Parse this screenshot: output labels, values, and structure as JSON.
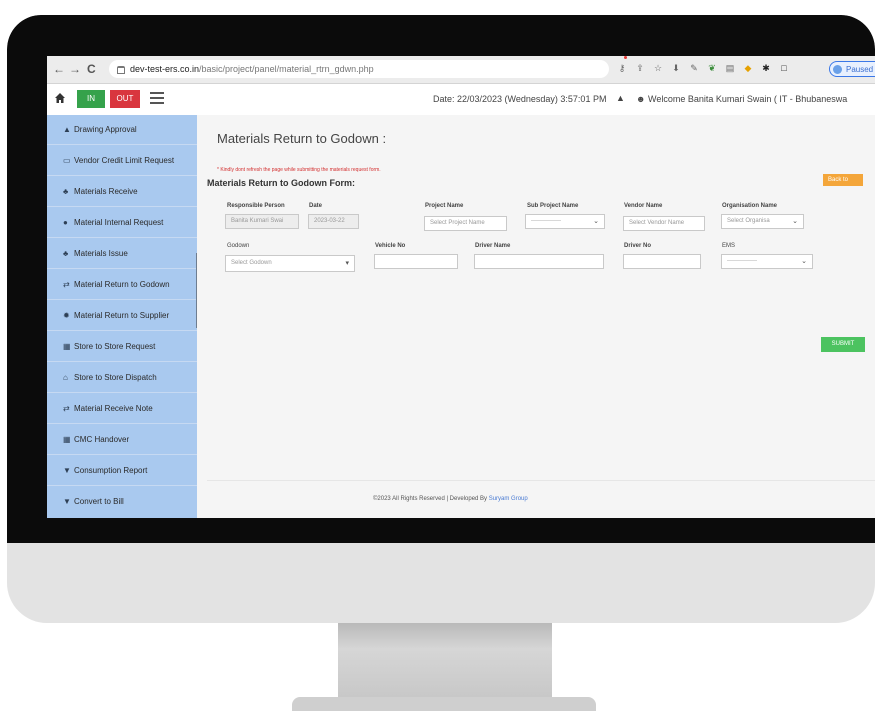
{
  "browser": {
    "back_glyph": "←",
    "forward_glyph": "→",
    "reload_glyph": "C",
    "url_host": "dev-test-ers.co.in",
    "url_path": "/basic/project/panel/material_rtrn_gdwn.php",
    "profile_status": "Paused"
  },
  "header": {
    "in_label": "IN",
    "out_label": "OUT",
    "date_text": "Date: 22/03/2023 (Wednesday) 3:57:01 PM",
    "welcome_text": "Welcome Banita Kumari Swain ( IT - Bhubaneswa"
  },
  "sidebar": {
    "items": [
      {
        "label": "Drawing Approval",
        "icon": "drawing-icon"
      },
      {
        "label": "Vendor Credit Limit Request",
        "icon": "credit-card-icon"
      },
      {
        "label": "Materials Receive",
        "icon": "handshake-icon"
      },
      {
        "label": "Material Internal Request",
        "icon": "globe-icon"
      },
      {
        "label": "Materials Issue",
        "icon": "handshake-icon"
      },
      {
        "label": "Material Return to Godown",
        "icon": "exchange-icon"
      },
      {
        "label": "Material Return to Supplier",
        "icon": "gear-icon"
      },
      {
        "label": "Store to Store Request",
        "icon": "table-icon"
      },
      {
        "label": "Store to Store Dispatch",
        "icon": "bank-icon"
      },
      {
        "label": "Material Receive Note",
        "icon": "exchange-icon"
      },
      {
        "label": "CMC Handover",
        "icon": "grid-icon"
      },
      {
        "label": "Consumption Report",
        "icon": "cart-icon"
      },
      {
        "label": "Convert to Bill",
        "icon": "cart-icon"
      }
    ]
  },
  "main": {
    "page_title": "Materials Return to Godown :",
    "warning": "* Kindly dont refresh the page while submitting the materials request form.",
    "form_title": "Materials Return to Godown Form:",
    "back_label": "Back to",
    "submit_label": "SUBMIT",
    "fields": {
      "responsible_person": {
        "label": "Responsible Person",
        "value": "Banita Kumari Swai"
      },
      "date": {
        "label": "Date",
        "value": "2023-03-22"
      },
      "project_name": {
        "label": "Project Name",
        "placeholder": "Select Project Name"
      },
      "sub_project_name": {
        "label": "Sub Project Name",
        "value": "---------------"
      },
      "vendor_name": {
        "label": "Vendor Name",
        "placeholder": "Select Vendor Name"
      },
      "organisation_name": {
        "label": "Organisation Name",
        "value": "Select Organisa"
      },
      "godown": {
        "label": "Godown",
        "value": "Select Godown"
      },
      "vehicle_no": {
        "label": "Vehicle No",
        "value": ""
      },
      "driver_name": {
        "label": "Driver Name",
        "value": ""
      },
      "driver_no": {
        "label": "Driver No",
        "value": ""
      },
      "ems": {
        "label": "EMS",
        "value": "---------------"
      }
    }
  },
  "footer": {
    "text": "©2023 All Rights Reserved | Developed By",
    "brand": "Suryam Group"
  }
}
